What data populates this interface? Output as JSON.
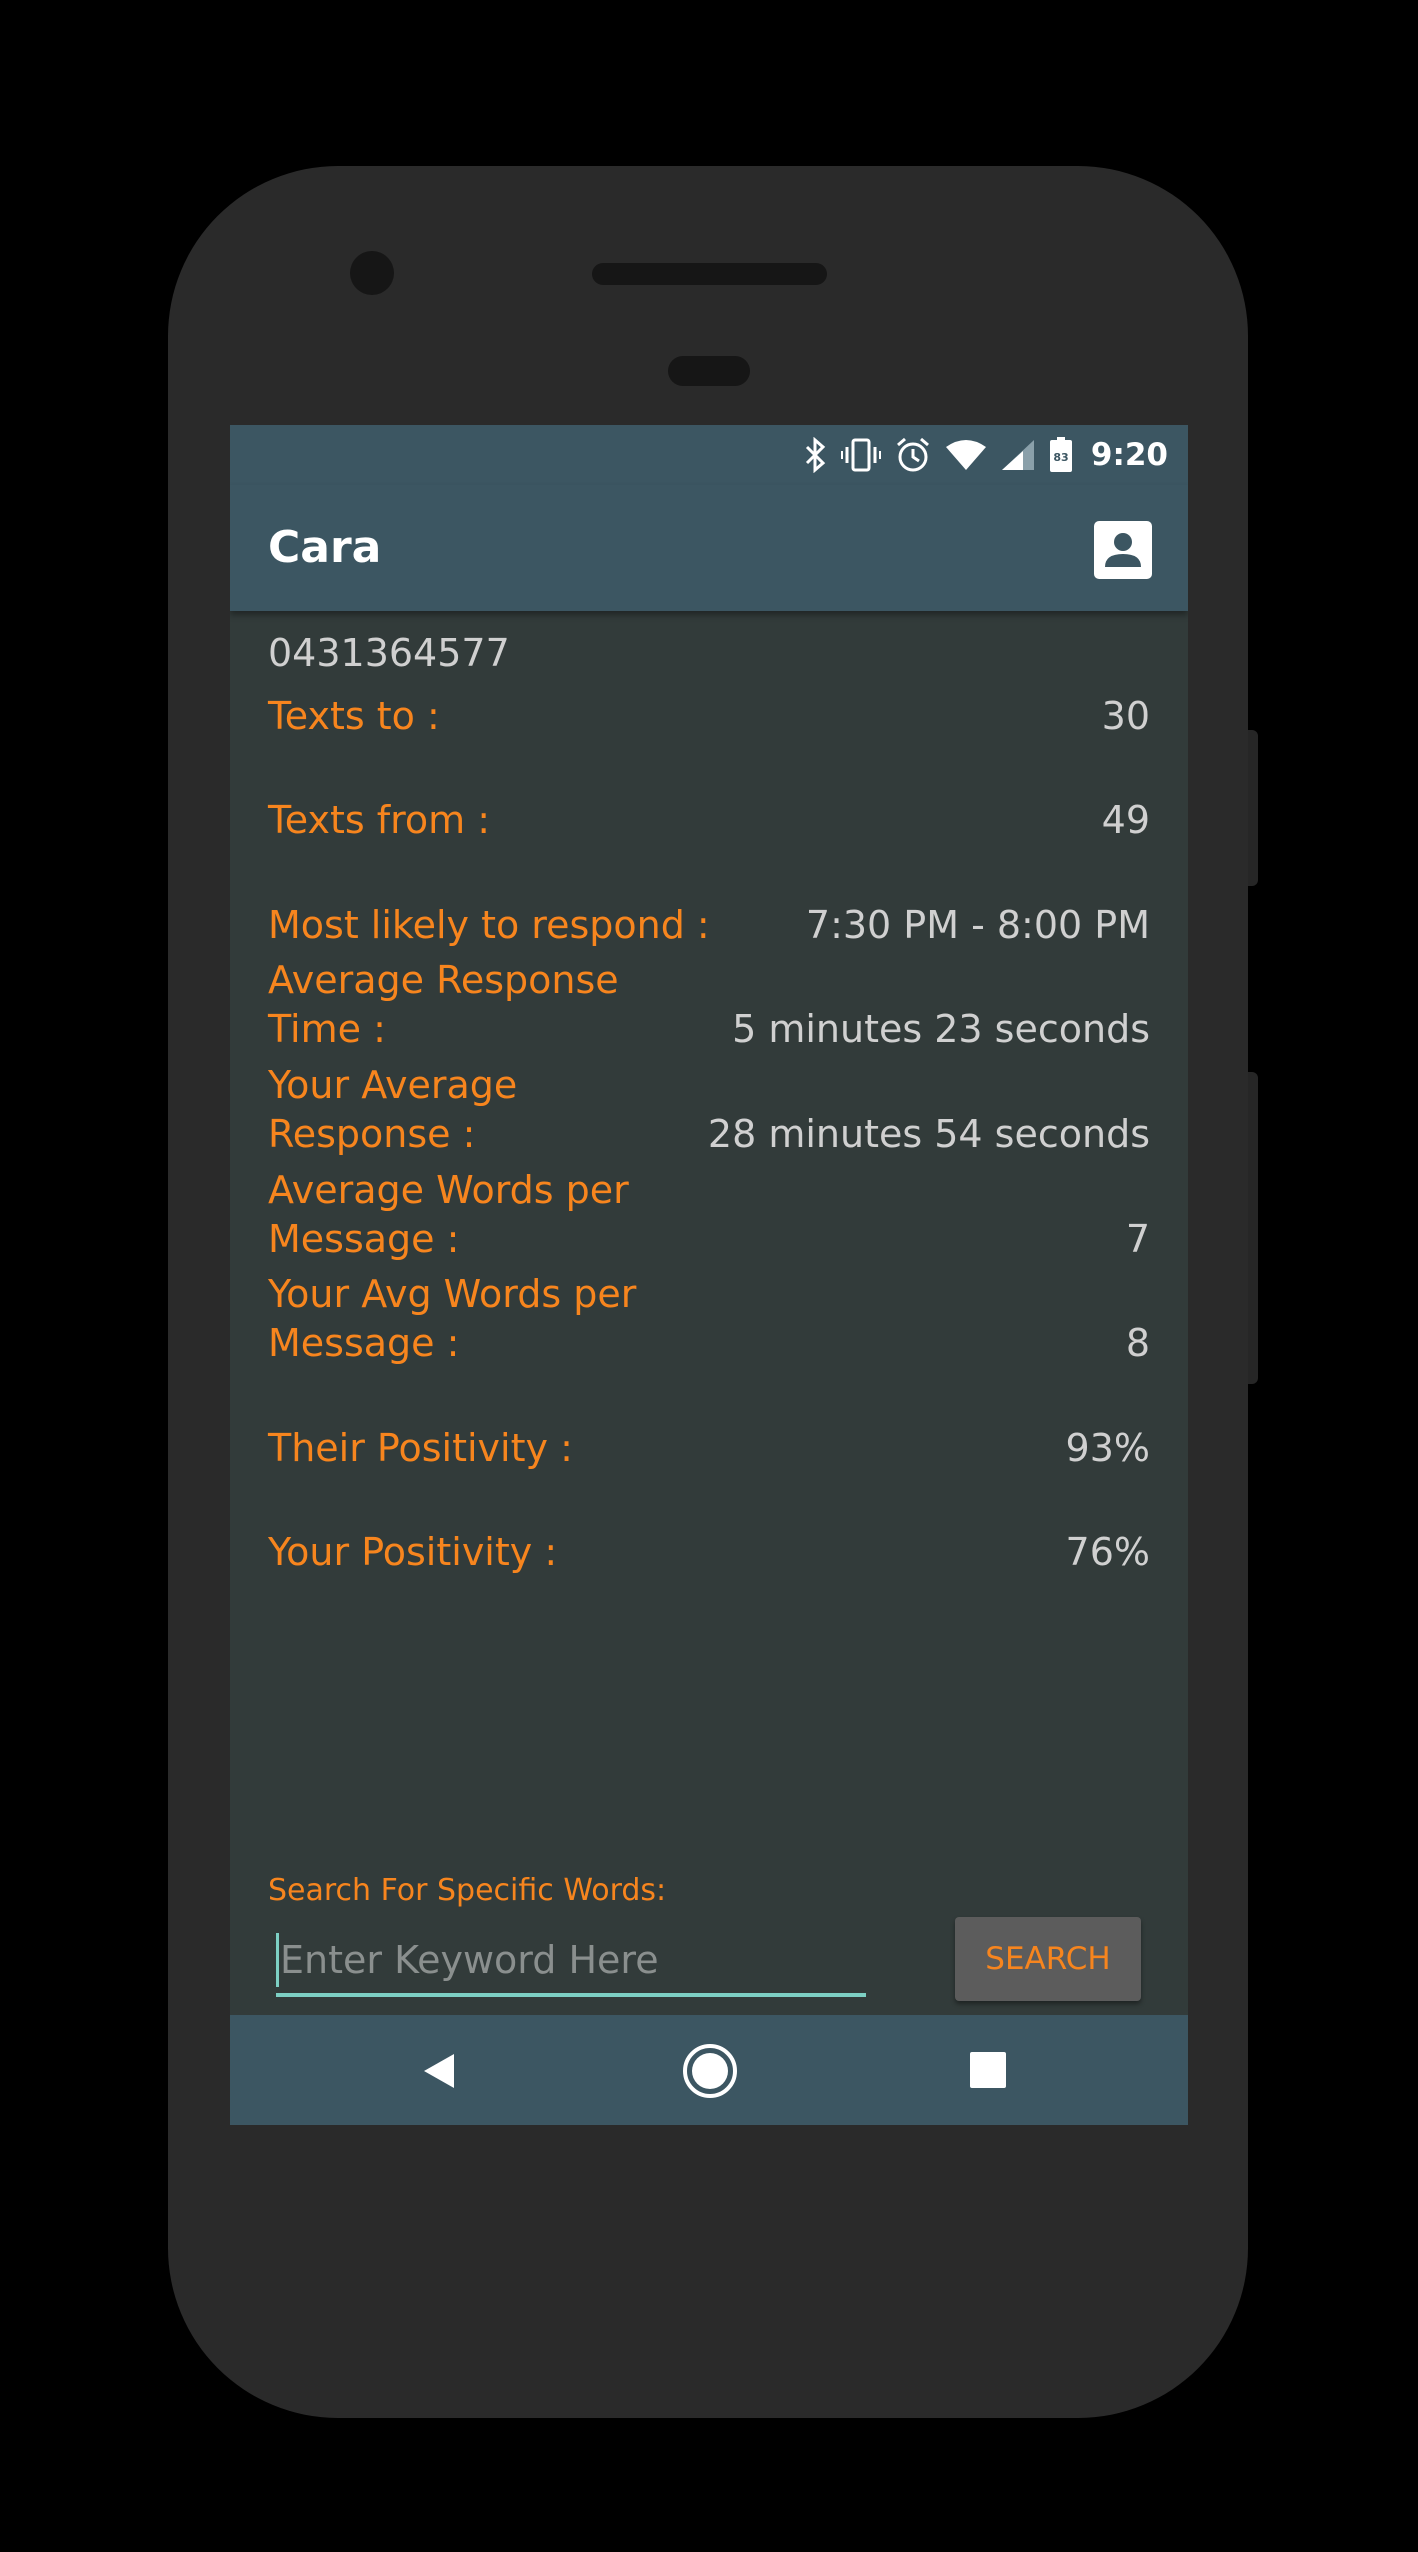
{
  "status_bar": {
    "time": "9:20",
    "battery_level": "83",
    "icons": [
      "bluetooth-icon",
      "vibrate-icon",
      "alarm-icon",
      "wifi-icon",
      "cell-signal-icon",
      "battery-icon"
    ]
  },
  "app_bar": {
    "title": "Cara",
    "action_icon": "contact-card-icon"
  },
  "contact": {
    "phone_number": "0431364577"
  },
  "stats": [
    {
      "label": "Texts to :",
      "value": "30"
    },
    {
      "label": "Texts from :",
      "value": "49"
    },
    {
      "label": "Most likely to respond :",
      "value": "7:30 PM - 8:00 PM"
    },
    {
      "label": "Average Response Time :",
      "value": "5 minutes 23 seconds"
    },
    {
      "label": "Your Average Response :",
      "value": "28 minutes 54 seconds"
    },
    {
      "label": "Average Words per Message :",
      "value": "7"
    },
    {
      "label": "Your Avg Words per Message :",
      "value": "8"
    },
    {
      "label": "Their Positivity :",
      "value": "93%"
    },
    {
      "label": "Your Positivity :",
      "value": "76%"
    }
  ],
  "search": {
    "label": "Search For Specific Words:",
    "placeholder": "Enter Keyword Here",
    "value": "",
    "button_label": "SEARCH"
  },
  "nav_bar": {
    "items": [
      "back-icon",
      "home-icon",
      "recents-icon"
    ]
  },
  "colors": {
    "accent": "#f7851e",
    "primary": "#3c5662",
    "background": "#323b3a",
    "input_underline": "#7dd0c4"
  }
}
